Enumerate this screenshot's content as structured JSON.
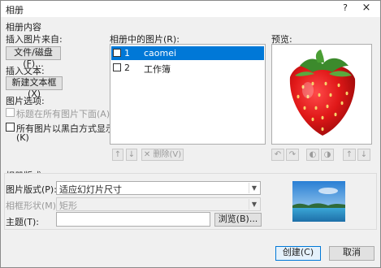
{
  "window": {
    "title": "相册",
    "help": "?",
    "close": "×"
  },
  "album_content": {
    "group_label": "相册内容",
    "insert_from_label": "插入图片来自:",
    "file_disk_button": "文件/磁盘(F)...",
    "insert_text_label": "插入文本:",
    "new_textbox_button": "新建文本框(X)",
    "picture_options_label": "图片选项:",
    "caption_below_label": "标题在所有图片下面(A)",
    "black_white_label_1": "所有图片以黑白方式显示",
    "black_white_label_2": "(K)"
  },
  "pictures": {
    "label": "相册中的图片(R):",
    "items": [
      {
        "num": "1",
        "name": "caomei",
        "selected": true
      },
      {
        "num": "2",
        "name": "工作簿",
        "selected": false
      }
    ],
    "delete_label": "删除(V)"
  },
  "preview": {
    "label": "预览:"
  },
  "layout": {
    "group_label": "相册版式",
    "picture_layout_label": "图片版式(P):",
    "picture_layout_value": "适应幻灯片尺寸",
    "frame_shape_label": "相框形状(M):",
    "frame_shape_value": "矩形",
    "theme_label": "主题(T):",
    "theme_value": "",
    "browse_button": "浏览(B)..."
  },
  "footer": {
    "create_button": "创建(C)",
    "cancel_button": "取消"
  }
}
